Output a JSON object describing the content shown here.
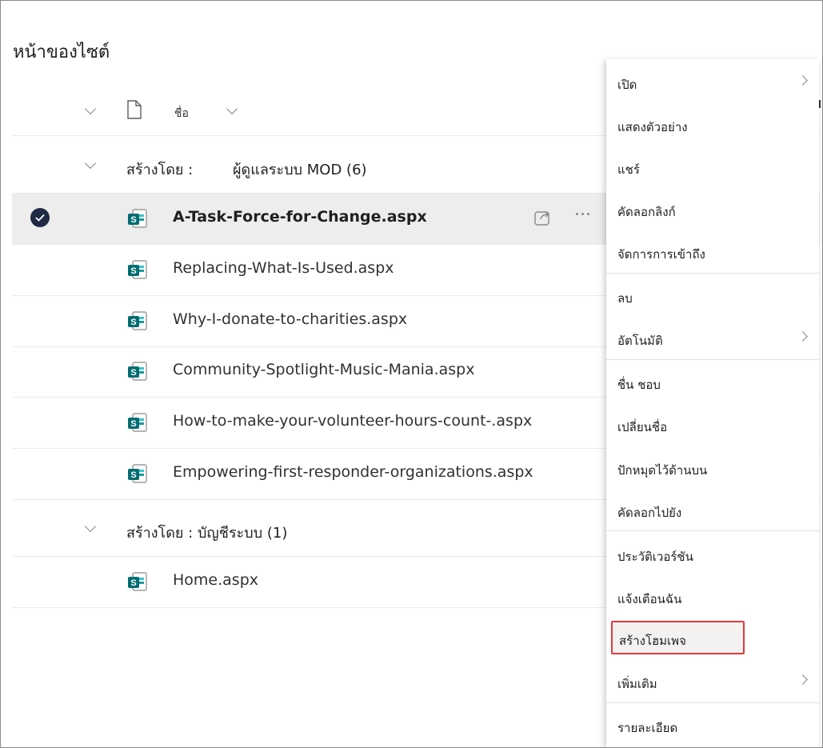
{
  "page": {
    "title": "หน้าของไซต์"
  },
  "header": {
    "name_column": "ชื่อ"
  },
  "groups": [
    {
      "label": "สร้างโดย :",
      "value": "ผู้ดูแลระบบ MOD (6)"
    },
    {
      "label": "สร้างโดย : บัญชีระบบ (1)",
      "value": ""
    }
  ],
  "files": [
    {
      "name": "A-Task-Force-for-Change.aspx",
      "selected": true
    },
    {
      "name": "Replacing-What-Is-Used.aspx"
    },
    {
      "name": "Why-I-donate-to-charities.aspx"
    },
    {
      "name": "Community-Spotlight-Music-Mania.aspx"
    },
    {
      "name": "How-to-make-your-volunteer-hours-count-.aspx"
    },
    {
      "name": "Empowering-first-responder-organizations.aspx"
    },
    {
      "name": "Home.aspx"
    }
  ],
  "menu": {
    "items": [
      {
        "label": "เปิด",
        "submenu": true
      },
      {
        "label": "แสดงตัวอย่าง"
      },
      {
        "label": "แชร์"
      },
      {
        "label": "คัดลอกลิงก์"
      },
      {
        "label": "จัดการการเข้าถึง"
      },
      {
        "label": "ลบ"
      },
      {
        "label": "อัตโนมัติ",
        "submenu": true
      },
      {
        "label": "ชื่น ชอบ"
      },
      {
        "label": "เปลี่ยนชื่อ"
      },
      {
        "label": "ปักหมุดไว้ด้านบน"
      },
      {
        "label": "คัดลอกไปยัง"
      },
      {
        "label": "ประวัติเวอร์ชัน"
      },
      {
        "label": "แจ้งเตือนฉัน"
      },
      {
        "label": "สร้างโฮมเพจ",
        "highlighted": true
      },
      {
        "label": "เพิ่มเติม",
        "submenu": true
      },
      {
        "label": "รายละเอียด"
      }
    ]
  },
  "colors": {
    "sharepoint_teal": "#036c70",
    "highlight_border": "#e0393e",
    "selected_row": "#ededed"
  }
}
